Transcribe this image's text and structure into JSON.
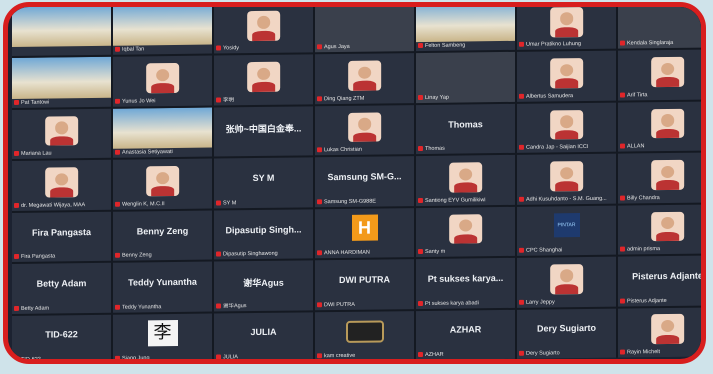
{
  "meeting": {
    "rows": [
      [
        {
          "kind": "wide",
          "name": ""
        },
        {
          "kind": "wide",
          "name": "Iqbal Tan"
        },
        {
          "kind": "face",
          "name": "Yosidy"
        },
        {
          "kind": "photo",
          "name": "Agus Jaya"
        },
        {
          "kind": "wide",
          "name": "Felton Sambeng"
        },
        {
          "kind": "face",
          "name": "Umar Pratikno Luhung"
        },
        {
          "kind": "photo",
          "name": "Kendala Singlaraja"
        }
      ],
      [
        {
          "kind": "wide",
          "name": "Pat Tantowi"
        },
        {
          "kind": "face",
          "name": "Yunus Jo Wei"
        },
        {
          "kind": "face",
          "name": "李明"
        },
        {
          "kind": "face",
          "name": "Ding Qiang ZTM"
        },
        {
          "kind": "photo",
          "name": "Linay Yap"
        },
        {
          "kind": "face",
          "name": "Albertus Samudera"
        },
        {
          "kind": "face",
          "name": "Arif Tirta"
        }
      ],
      [
        {
          "kind": "face",
          "name": "Mariana Lau"
        },
        {
          "kind": "wide",
          "name": "Anastasia Setiyawati"
        },
        {
          "kind": "text",
          "center": "张帅~中国白金奉...",
          "name": ""
        },
        {
          "kind": "face",
          "name": "Lukas Christian"
        },
        {
          "kind": "text",
          "center": "Thomas",
          "name": "Thomas"
        },
        {
          "kind": "face",
          "name": "Candra Jap - Saijian ICCI"
        },
        {
          "kind": "face",
          "name": "ALLAN"
        }
      ],
      [
        {
          "kind": "face",
          "name": "dr. Megawati Wijaya, MAA"
        },
        {
          "kind": "face",
          "name": "Wenglin K, M.C.II"
        },
        {
          "kind": "text",
          "center": "SY M",
          "name": "SY M"
        },
        {
          "kind": "text",
          "center": "Samsung SM-G...",
          "name": "Samsung SM-G988E"
        },
        {
          "kind": "face",
          "name": "Santiong EYV Gumilikiwi"
        },
        {
          "kind": "face",
          "name": "Adhi Kusuhdanto - S.M. Guang..."
        },
        {
          "kind": "face",
          "name": "Billy Chandra"
        }
      ],
      [
        {
          "kind": "text",
          "center": "Fira Pangasta",
          "name": "Fira Pangasta"
        },
        {
          "kind": "text",
          "center": "Benny Zeng",
          "name": "Benny Zeng"
        },
        {
          "kind": "text",
          "center": "Dipasutip Singh...",
          "name": "Dipasutip Singhawong"
        },
        {
          "kind": "logo-h",
          "logo": "H",
          "name": "ANNA HARDIMAN"
        },
        {
          "kind": "face",
          "name": "Santy m"
        },
        {
          "kind": "logo-dark",
          "logo": "PINTAR",
          "name": "CPC Shanghai"
        },
        {
          "kind": "face",
          "name": "admin prisma"
        }
      ],
      [
        {
          "kind": "text",
          "center": "Betty Adam",
          "name": "Betty Adam"
        },
        {
          "kind": "text",
          "center": "Teddy Yunantha",
          "name": "Teddy Yunantha"
        },
        {
          "kind": "text",
          "center": "谢华Agus",
          "name": "谢华Agus"
        },
        {
          "kind": "text",
          "center": "DWI PUTRA",
          "name": "DWI PUTRA"
        },
        {
          "kind": "text",
          "center": "Pt sukses karya...",
          "name": "Pt sukses karya abadi"
        },
        {
          "kind": "face",
          "name": "Larry Jeppy"
        },
        {
          "kind": "text",
          "center": "Pisterus Adjante",
          "name": "Pisterus Adjante"
        }
      ],
      [
        {
          "kind": "text",
          "center": "TID-622",
          "name": "TID-622"
        },
        {
          "kind": "char",
          "logo": "李",
          "name": "Siang Jung"
        },
        {
          "kind": "text",
          "center": "JULIA",
          "name": "JULIA"
        },
        {
          "kind": "ring",
          "name": "kam creative"
        },
        {
          "kind": "text",
          "center": "AZHAR",
          "name": "AZHAR"
        },
        {
          "kind": "text",
          "center": "Dery Sugiarto",
          "name": "Dery Sugiarto"
        },
        {
          "kind": "face",
          "name": "Rayin Michelt"
        }
      ]
    ]
  },
  "colors": {
    "frame": "#d81e1e",
    "tile": "#2a3140",
    "mic": "#e0262a"
  }
}
